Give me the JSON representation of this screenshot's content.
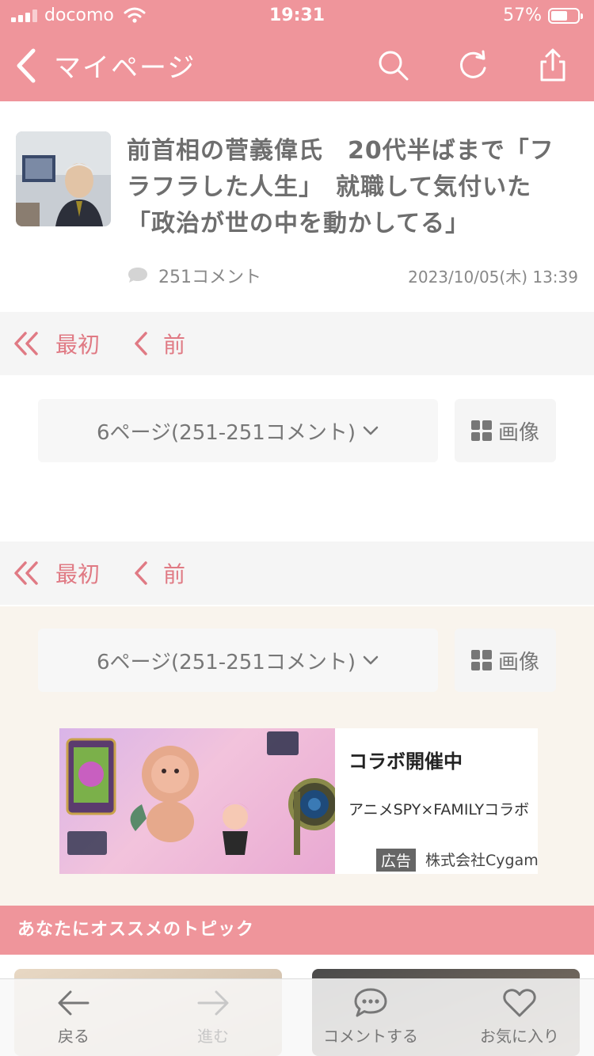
{
  "status": {
    "carrier": "docomo",
    "time": "19:31",
    "battery": "57%"
  },
  "nav": {
    "title": "マイページ"
  },
  "article": {
    "headline": "前首相の菅義偉氏　20代半ばまで「フラフラした人生」　就職して気付いた「政治が世の中を動かしてる」",
    "comments": "251コメント",
    "datetime": "2023/10/05(木) 13:39"
  },
  "pager": {
    "first": "最初",
    "prev": "前"
  },
  "page_select": {
    "value": "6ページ(251-251コメント)",
    "image_label": "画像"
  },
  "ad": {
    "title": "コラボ開催中",
    "description": "アニメSPY×FAMILYコラボ",
    "badge": "広告",
    "sponsor": "株式会社Cygam"
  },
  "recommend": {
    "title": "あなたにオススメのトピック"
  },
  "tabbar": {
    "back": "戻る",
    "forward": "進む",
    "comment": "コメントする",
    "favorite": "お気に入り"
  },
  "colors": {
    "accent": "#ef959b",
    "link": "#e07a84",
    "cream": "#f9f4ed"
  }
}
